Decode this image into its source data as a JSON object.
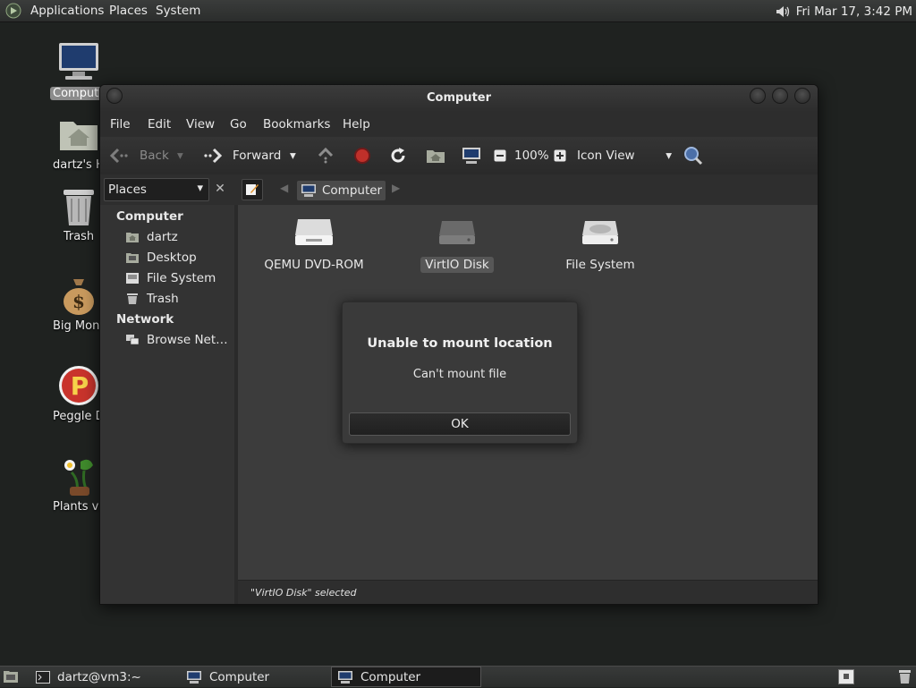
{
  "top_panel": {
    "menus": [
      "Applications",
      "Places",
      "System"
    ],
    "clock": "Fri Mar 17,  3:42 PM"
  },
  "desktop_icons": [
    {
      "label": "Computer",
      "icon": "computer-icon",
      "selected": true
    },
    {
      "label": "dartz's Home",
      "icon": "home-folder-icon"
    },
    {
      "label": "Trash",
      "icon": "trash-icon"
    },
    {
      "label": "Big Money Deluxe",
      "icon": "money-bag-icon"
    },
    {
      "label": "Peggle Deluxe",
      "icon": "peggle-icon"
    },
    {
      "label": "Plants vs Zombies",
      "icon": "plants-icon"
    }
  ],
  "window": {
    "title": "Computer",
    "menus": [
      "File",
      "Edit",
      "View",
      "Go",
      "Bookmarks",
      "Help"
    ],
    "toolbar": {
      "back": "Back",
      "forward": "Forward",
      "zoom": "100%",
      "view_mode": "Icon View"
    },
    "location": {
      "side_pane_title": "Places",
      "current": "Computer"
    },
    "sidebar": {
      "computer_header": "Computer",
      "computer_items": [
        "dartz",
        "Desktop",
        "File System",
        "Trash"
      ],
      "network_header": "Network",
      "network_items": [
        "Browse Net…"
      ]
    },
    "files": [
      {
        "label": "QEMU DVD-ROM",
        "icon": "optical-drive-icon"
      },
      {
        "label": "VirtIO Disk",
        "icon": "hard-disk-icon",
        "selected": true
      },
      {
        "label": "File System",
        "icon": "file-system-icon"
      }
    ],
    "status": "\"VirtIO Disk\" selected"
  },
  "dialog": {
    "title": "Unable to mount location",
    "message": "Can't mount file",
    "button": "OK"
  },
  "taskbar": {
    "items": [
      {
        "label": "dartz@vm3:~",
        "icon": "terminal-icon"
      },
      {
        "label": "Computer",
        "icon": "computer-icon"
      },
      {
        "label": "Computer",
        "icon": "computer-icon",
        "active": true
      }
    ]
  }
}
